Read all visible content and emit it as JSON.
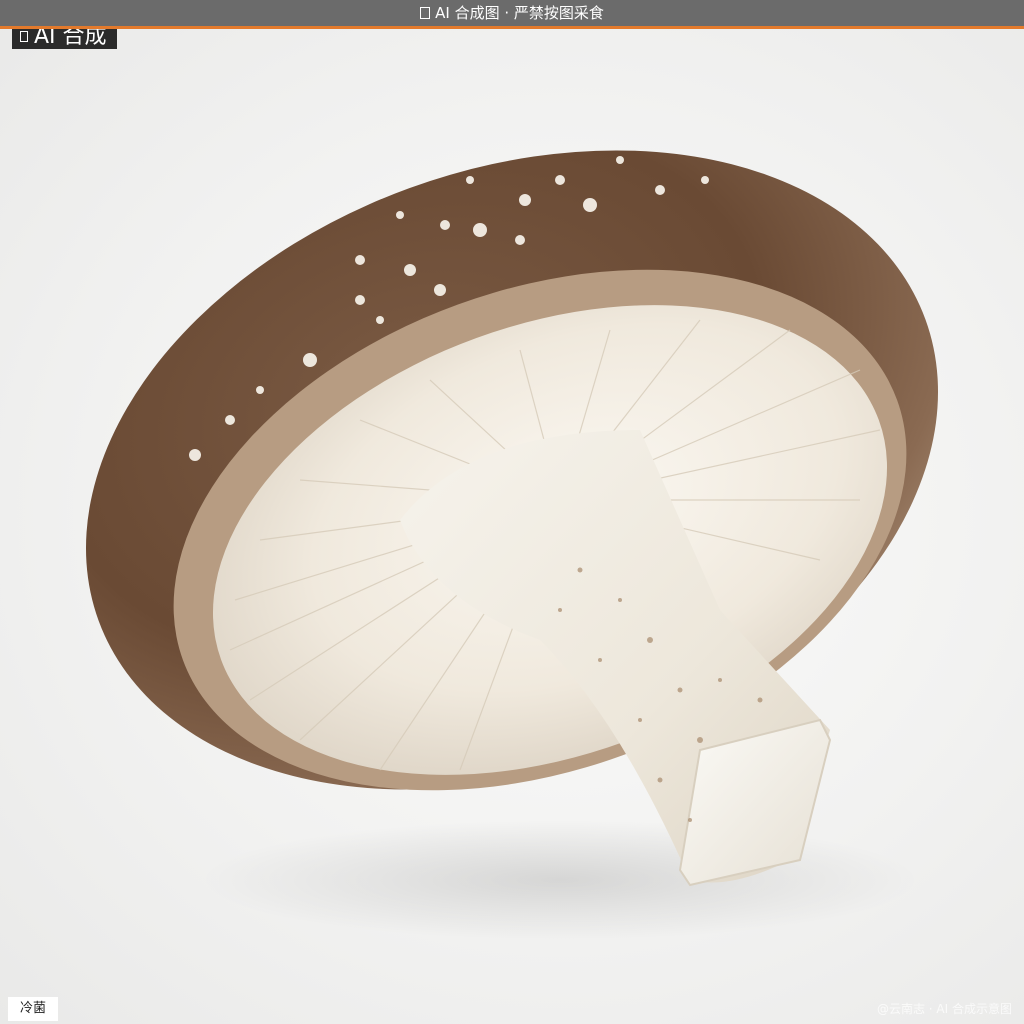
{
  "banner": {
    "text": "AI 合成图 · 严禁按图采食",
    "icon": "ai-notice-icon"
  },
  "badge": {
    "text": "AI 合成",
    "icon": "ai-badge-icon"
  },
  "caption": {
    "text": "冷菌"
  },
  "watermark": {
    "text": "@云南志 · AI 合成示意图"
  },
  "colors": {
    "banner_bg": "#6b6b6b",
    "banner_accent": "#e37a2c",
    "badge_bg": "#2b2b2b",
    "cap_brown": "#6a4a34",
    "gill_cream": "#efe8dc",
    "stem_white": "#f1ede4",
    "background": "#f1f1f0"
  }
}
